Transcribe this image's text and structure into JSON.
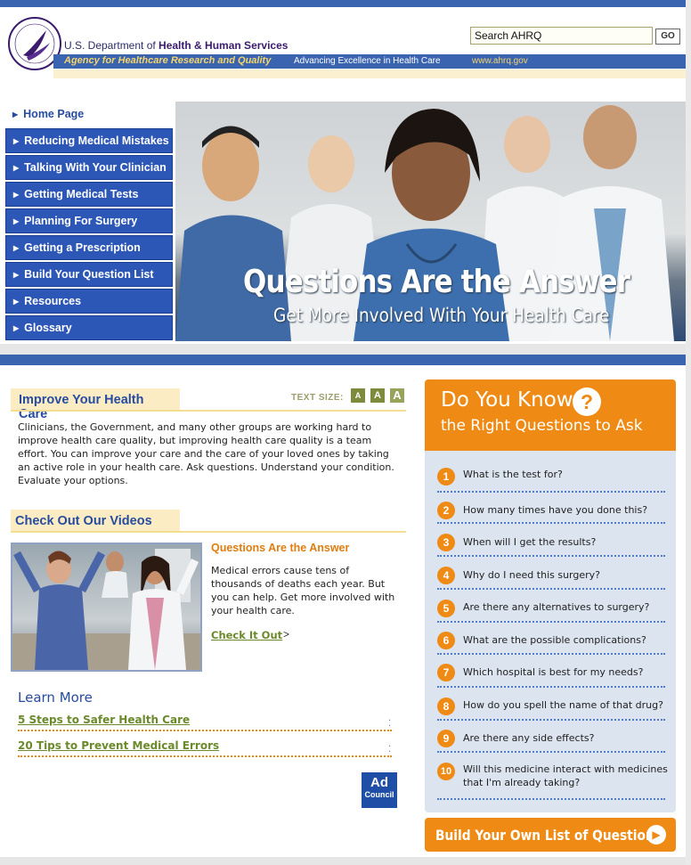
{
  "header": {
    "dept_prefix": "U.S. Department of ",
    "dept_name": "Health & Human Services",
    "agency": "Agency for Healthcare Research and Quality",
    "tagline": "Advancing Excellence in Health Care",
    "url": "www.ahrq.gov",
    "search_value": "Search AHRQ",
    "go_label": "GO"
  },
  "nav": {
    "items": [
      {
        "label": "Home Page"
      },
      {
        "label": "Reducing Medical Mistakes"
      },
      {
        "label": "Talking With Your Clinician"
      },
      {
        "label": "Getting Medical Tests"
      },
      {
        "label": "Planning For Surgery"
      },
      {
        "label": "Getting a Prescription"
      },
      {
        "label": "Build Your Question List"
      },
      {
        "label": "Resources"
      },
      {
        "label": "Glossary"
      }
    ]
  },
  "hero": {
    "title": "Questions Are the Answer",
    "subtitle": "Get More Involved With Your Health Care"
  },
  "improve": {
    "heading": "Improve Your Health Care",
    "text_size_label": "TEXT SIZE:",
    "size_small": "A",
    "size_medium": "A",
    "size_large": "A",
    "body": "Clinicians, the Government, and many other groups are working hard to improve health care quality, but improving health care quality is a team effort. You can improve your care and the care of your loved ones by taking an active role in your health care. Ask questions. Understand your condition. Evaluate your options."
  },
  "videos": {
    "heading": "Check Out Our Videos",
    "title": "Questions Are the Answer",
    "description": "Medical errors cause tens of thousands of deaths each year. But you can help. Get more involved with your health care.",
    "link": "Check It Out",
    "link_arrow": ">"
  },
  "learn_more": {
    "heading": "Learn More",
    "links": [
      "5 Steps to Safer Health Care",
      "20 Tips to Prevent Medical Errors"
    ]
  },
  "ad_council": {
    "line1": "Ad",
    "line2": "Council"
  },
  "do_you_know": {
    "title": "Do You Know",
    "icon_glyph": "?",
    "subtitle": "the Right Questions to Ask",
    "questions": [
      {
        "num": "1",
        "text": "What is the test for?"
      },
      {
        "num": "2",
        "text": "How many times have you done this?"
      },
      {
        "num": "3",
        "text": "When will I get the results?"
      },
      {
        "num": "4",
        "text": "Why do I need this surgery?"
      },
      {
        "num": "5",
        "text": "Are there any alternatives to surgery?"
      },
      {
        "num": "6",
        "text": "What are the possible complications?"
      },
      {
        "num": "7",
        "text": "Which hospital is best for my needs?"
      },
      {
        "num": "8",
        "text": "How do you spell the name of that drug?"
      },
      {
        "num": "9",
        "text": "Are there any side effects?"
      },
      {
        "num": "10",
        "text": "Will this medicine interact with medicines that I'm already taking?"
      }
    ],
    "build_button": "Build Your Own List of Questions"
  },
  "colors": {
    "brand_blue": "#3a63b0",
    "nav_blue": "#2d57b7",
    "accent_orange": "#ef8a14",
    "link_green": "#6b8a2b"
  }
}
